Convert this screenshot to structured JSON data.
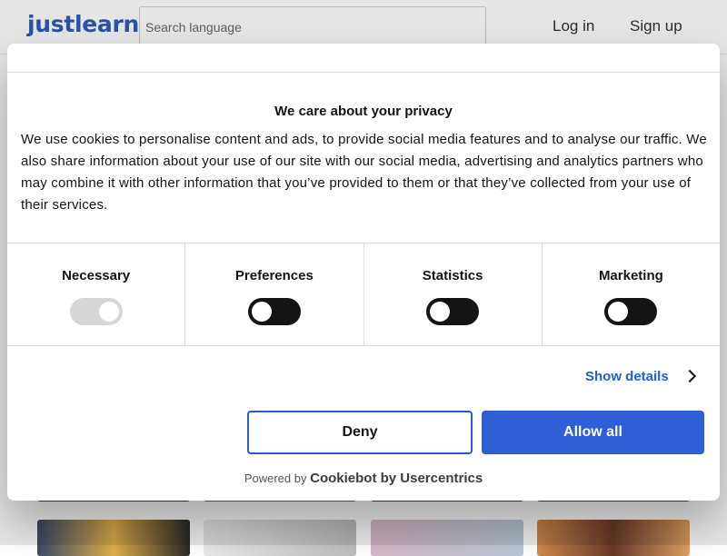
{
  "header": {
    "logo": "justlearn",
    "search_placeholder": "Search language",
    "login": "Log in",
    "signup": "Sign up"
  },
  "cookie_dialog": {
    "title": "We care about your privacy",
    "body": "We use cookies to personalise content and ads, to provide social media features and to analyse our traffic. We also share information about your use of our site with our social media, advertising and analytics partners who may combine it with other information that you’ve provided to them or that they’ve collected from your use of their services.",
    "toggles": [
      {
        "label": "Necessary",
        "checked": true,
        "disabled": true
      },
      {
        "label": "Preferences",
        "checked": false,
        "disabled": false
      },
      {
        "label": "Statistics",
        "checked": false,
        "disabled": false
      },
      {
        "label": "Marketing",
        "checked": false,
        "disabled": false
      }
    ],
    "show_details": "Show details",
    "deny": "Deny",
    "allow_all": "Allow all",
    "powered_by": "Powered by",
    "powered_brand": "Cookiebot by Usercentrics"
  },
  "colors": {
    "brand": "#2f5bb8",
    "accent": "#2e5fd6",
    "toggle_off": "#141414",
    "toggle_disabled": "#d6d6d6"
  }
}
